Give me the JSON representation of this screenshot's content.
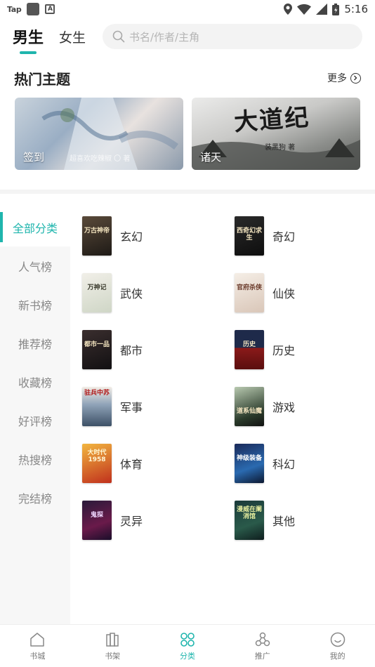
{
  "status_bar": {
    "carrier_label": "Tap",
    "time": "5:16"
  },
  "header": {
    "tabs": [
      {
        "label": "男生",
        "active": true
      },
      {
        "label": "女生",
        "active": false
      }
    ],
    "search": {
      "placeholder": "书名/作者/主角"
    }
  },
  "hot_topics": {
    "title": "热门主题",
    "more_label": "更多",
    "banners": [
      {
        "label": "签到",
        "caption": "超喜欢吃辣椒 〇 著"
      },
      {
        "label": "诸天",
        "caption": "装黑狗 著",
        "art_title": "大道纪"
      }
    ]
  },
  "sidebar": {
    "items": [
      {
        "label": "全部分类",
        "active": true
      },
      {
        "label": "人气榜"
      },
      {
        "label": "新书榜"
      },
      {
        "label": "推荐榜"
      },
      {
        "label": "收藏榜"
      },
      {
        "label": "好评榜"
      },
      {
        "label": "热搜榜"
      },
      {
        "label": "完结榜"
      }
    ]
  },
  "categories": [
    {
      "label": "玄幻",
      "cover_text": "万古神帝"
    },
    {
      "label": "奇幻",
      "cover_text": "西奇幻求生"
    },
    {
      "label": "武侠",
      "cover_text": "万神记"
    },
    {
      "label": "仙侠",
      "cover_text": "官府杀侠"
    },
    {
      "label": "都市",
      "cover_text": "都市一品"
    },
    {
      "label": "历史",
      "cover_text": "历史"
    },
    {
      "label": "军事",
      "cover_text": "驻兵中苏"
    },
    {
      "label": "游戏",
      "cover_text": "道系仙魔"
    },
    {
      "label": "体育",
      "cover_text": "大时代1958"
    },
    {
      "label": "科幻",
      "cover_text": "神级装备"
    },
    {
      "label": "灵异",
      "cover_text": "鬼探"
    },
    {
      "label": "其他",
      "cover_text": "漫威在阑消馆"
    }
  ],
  "bottom_nav": {
    "items": [
      {
        "label": "书城",
        "icon": "home-icon"
      },
      {
        "label": "书架",
        "icon": "bookshelf-icon"
      },
      {
        "label": "分类",
        "icon": "category-icon",
        "active": true
      },
      {
        "label": "推广",
        "icon": "share-icon"
      },
      {
        "label": "我的",
        "icon": "profile-icon"
      }
    ]
  },
  "colors": {
    "accent": "#1fb5ad",
    "sidebar_bg": "#f7f7f7",
    "search_bg": "#f3f3f3"
  }
}
